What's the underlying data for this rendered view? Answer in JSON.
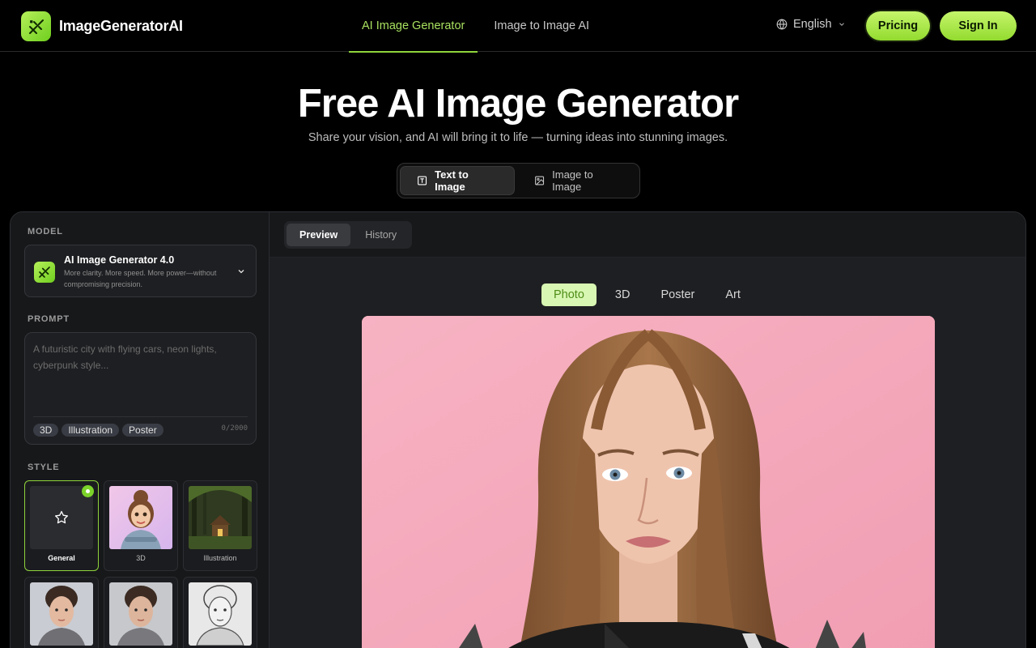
{
  "brand": {
    "name": "ImageGeneratorAI"
  },
  "nav": [
    {
      "label": "AI Image Generator",
      "active": true
    },
    {
      "label": "Image to Image AI",
      "active": false
    }
  ],
  "header": {
    "language": "English",
    "pricing_label": "Pricing",
    "signin_label": "Sign In"
  },
  "hero": {
    "title": "Free AI Image Generator",
    "subtitle": "Share your vision, and AI will bring it to life — turning ideas into stunning images."
  },
  "modes": [
    {
      "label": "Text to Image",
      "icon": "text-box-icon",
      "active": true
    },
    {
      "label": "Image to Image",
      "icon": "image-icon",
      "active": false
    }
  ],
  "sidebar": {
    "model_label": "MODEL",
    "model": {
      "name": "AI Image Generator 4.0",
      "description": "More clarity. More speed. More power—without compromising precision."
    },
    "prompt_label": "PROMPT",
    "prompt": {
      "value": "",
      "placeholder": "A futuristic city with flying cars, neon lights, cyberpunk style...",
      "tags": [
        "3D",
        "Illustration",
        "Poster"
      ],
      "count": "0/2000"
    },
    "style_label": "STYLE",
    "styles": [
      {
        "label": "General",
        "selected": true
      },
      {
        "label": "3D",
        "selected": false
      },
      {
        "label": "Illustration",
        "selected": false
      },
      {
        "label": "",
        "selected": false
      },
      {
        "label": "",
        "selected": false
      },
      {
        "label": "",
        "selected": false
      }
    ]
  },
  "preview": {
    "tabs": [
      {
        "label": "Preview",
        "active": true
      },
      {
        "label": "History",
        "active": false
      }
    ],
    "categories": [
      {
        "label": "Photo",
        "active": true
      },
      {
        "label": "3D",
        "active": false
      },
      {
        "label": "Poster",
        "active": false
      },
      {
        "label": "Art",
        "active": false
      }
    ]
  },
  "colors": {
    "accent": "#93db2f",
    "accent_light": "#c5f56b",
    "nav_active": "#a8e05f",
    "preview_bg": "#f4a9bb"
  }
}
